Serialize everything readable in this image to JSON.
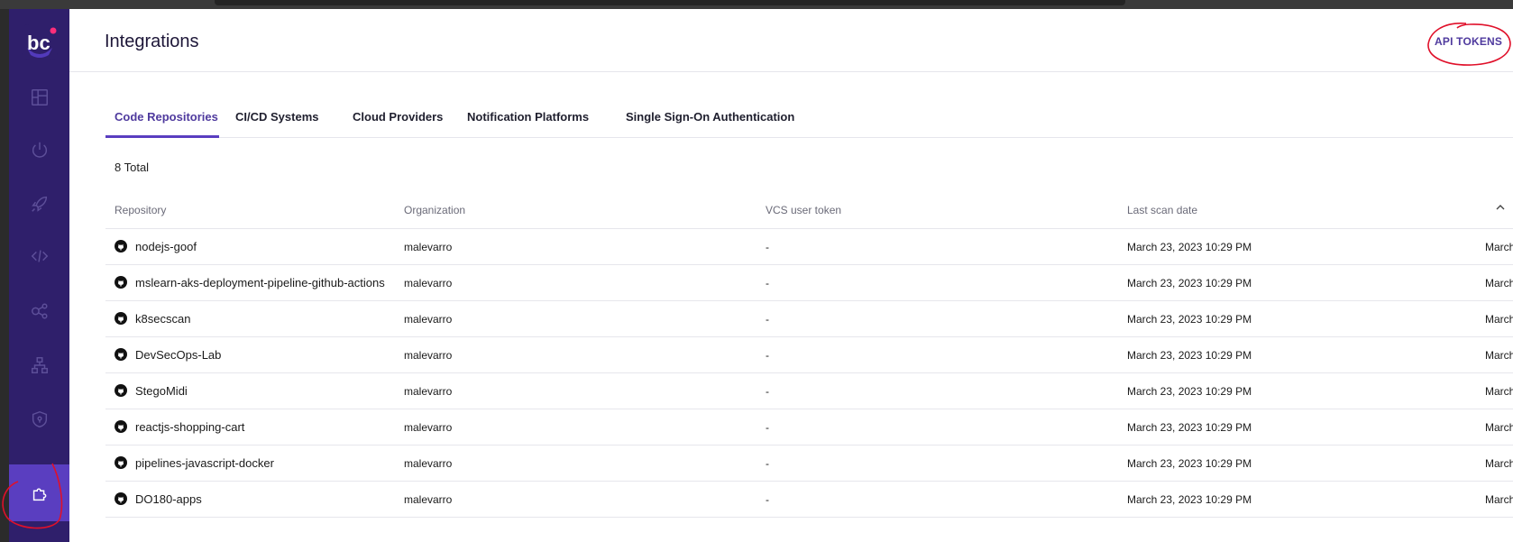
{
  "app": {
    "logo_text": "bc"
  },
  "sidebar": {
    "items": [
      {
        "icon": "dashboard-icon",
        "active": false
      },
      {
        "icon": "power-icon",
        "active": false
      },
      {
        "icon": "rocket-icon",
        "active": false
      },
      {
        "icon": "code-icon",
        "active": false
      },
      {
        "icon": "share-nodes-icon",
        "active": false
      },
      {
        "icon": "hierarchy-icon",
        "active": false
      },
      {
        "icon": "shield-icon",
        "active": false
      },
      {
        "icon": "puzzle-icon",
        "active": true
      }
    ]
  },
  "header": {
    "title": "Integrations",
    "api_tokens_label": "API TOKENS"
  },
  "tabs": [
    {
      "label": "Code Repositories",
      "active": true
    },
    {
      "label": "CI/CD Systems",
      "active": false
    },
    {
      "label": "Cloud Providers",
      "active": false
    },
    {
      "label": "Notification Platforms",
      "active": false
    },
    {
      "label": "Single Sign-On Authentication",
      "active": false
    }
  ],
  "total_label": "8 Total",
  "table": {
    "columns": [
      "Repository",
      "Organization",
      "VCS user token",
      "Last scan date"
    ],
    "rows": [
      {
        "repository": "nodejs-goof",
        "organization": "malevarro",
        "token": "-",
        "last_scan": "March 23, 2023 10:29 PM",
        "extra": "March"
      },
      {
        "repository": "mslearn-aks-deployment-pipeline-github-actions",
        "organization": "malevarro",
        "token": "-",
        "last_scan": "March 23, 2023 10:29 PM",
        "extra": "March"
      },
      {
        "repository": "k8secscan",
        "organization": "malevarro",
        "token": "-",
        "last_scan": "March 23, 2023 10:29 PM",
        "extra": "March"
      },
      {
        "repository": "DevSecOps-Lab",
        "organization": "malevarro",
        "token": "-",
        "last_scan": "March 23, 2023 10:29 PM",
        "extra": "March"
      },
      {
        "repository": "StegoMidi",
        "organization": "malevarro",
        "token": "-",
        "last_scan": "March 23, 2023 10:29 PM",
        "extra": "March"
      },
      {
        "repository": "reactjs-shopping-cart",
        "organization": "malevarro",
        "token": "-",
        "last_scan": "March 23, 2023 10:29 PM",
        "extra": "March"
      },
      {
        "repository": "pipelines-javascript-docker",
        "organization": "malevarro",
        "token": "-",
        "last_scan": "March 23, 2023 10:29 PM",
        "extra": "March"
      },
      {
        "repository": "DO180-apps",
        "organization": "malevarro",
        "token": "-",
        "last_scan": "March 23, 2023 10:29 PM",
        "extra": "March"
      }
    ]
  },
  "colors": {
    "sidebar_bg": "#2f1f6b",
    "sidebar_active": "#5a3ec0",
    "accent": "#4f3a9e",
    "annotation": "#e0102a"
  }
}
